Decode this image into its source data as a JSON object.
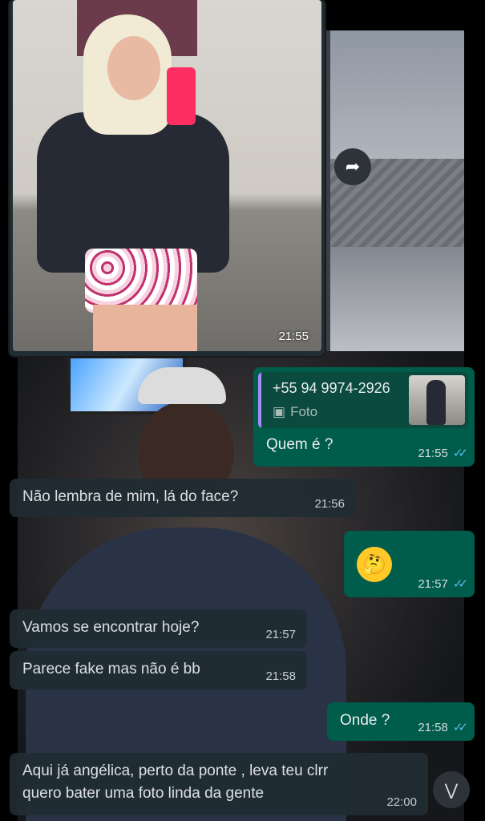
{
  "photo_message": {
    "time": "21:55"
  },
  "icons": {
    "share": "share-icon",
    "photo": "photo-icon",
    "scroll_down": "double-chevron-down-icon",
    "read_receipt": "double-check-icon"
  },
  "messages": [
    {
      "direction": "out",
      "quote": {
        "name": "+55 94 9974-2926",
        "type": "Foto"
      },
      "text": "Quem é ?",
      "time": "21:55",
      "read": true
    },
    {
      "direction": "in",
      "text": "Não lembra  de mim, lá do face?",
      "time": "21:56"
    },
    {
      "direction": "out",
      "emoji": "🤔",
      "time": "21:57",
      "read": true
    },
    {
      "direction": "in",
      "text": "Vamos  se encontrar hoje?",
      "time": "21:57"
    },
    {
      "direction": "in",
      "text": "Parece fake  mas não é bb",
      "time": "21:58"
    },
    {
      "direction": "out",
      "text": "Onde ?",
      "time": "21:58",
      "read": true
    },
    {
      "direction": "in",
      "text_line1": "Aqui já angélica, perto da ponte , leva teu clrr",
      "text_line2": "quero bater uma foto linda da gente",
      "time": "22:00"
    }
  ],
  "colors": {
    "incoming": "#202c33",
    "outgoing": "#005c4b",
    "read_ticks": "#53bdeb"
  }
}
